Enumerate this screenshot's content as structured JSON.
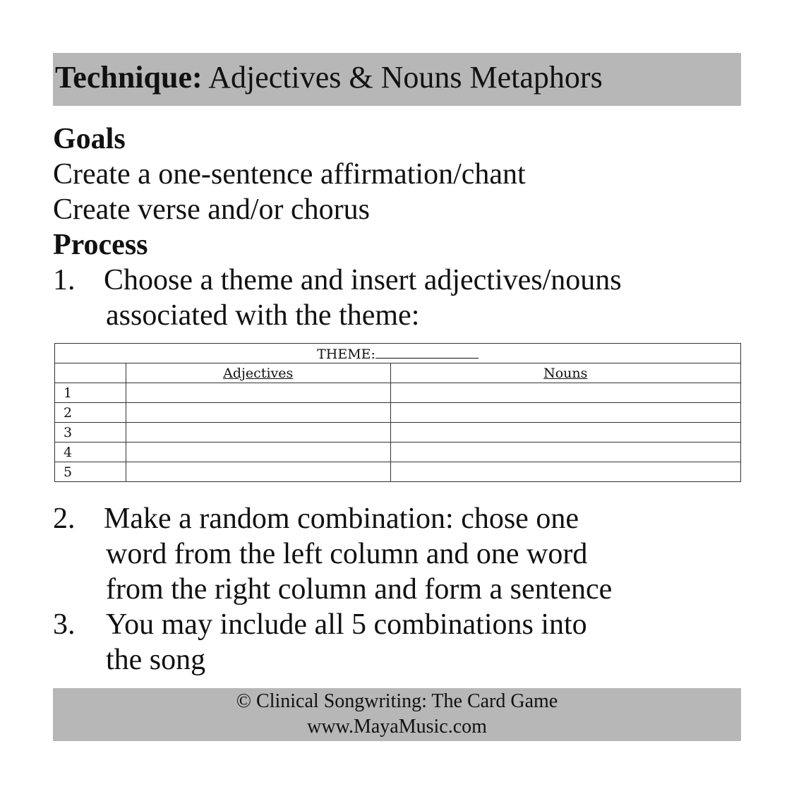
{
  "header": {
    "label": "Technique:",
    "title": "Adjectives & Nouns Metaphors"
  },
  "goals": {
    "heading": "Goals",
    "items": [
      "Create a one-sentence affirmation/chant",
      "Create verse and/or chorus"
    ]
  },
  "process": {
    "heading": "Process",
    "steps": [
      {
        "num": "1.",
        "lines": [
          "Choose a theme and insert adjectives/nouns",
          "associated with the theme:"
        ]
      },
      {
        "num": "2.",
        "lines": [
          "Make a random combination: chose one",
          "word from the left column and one word",
          "from the right column and form a sentence"
        ]
      },
      {
        "num": "3.",
        "lines": [
          "You may include all 5 combinations into",
          "the song"
        ]
      }
    ]
  },
  "table": {
    "theme_label": "THEME:",
    "headers": [
      "",
      "Adjectives",
      "Nouns"
    ],
    "rows": [
      "1",
      "2",
      "3",
      "4",
      "5"
    ]
  },
  "footer": {
    "line1": "© Clinical Songwriting: The Card Game",
    "line2": "www.MayaMusic.com"
  },
  "colors": {
    "bar_background": "#b7b7b7",
    "text": "#111111",
    "table_border": "#333333"
  }
}
